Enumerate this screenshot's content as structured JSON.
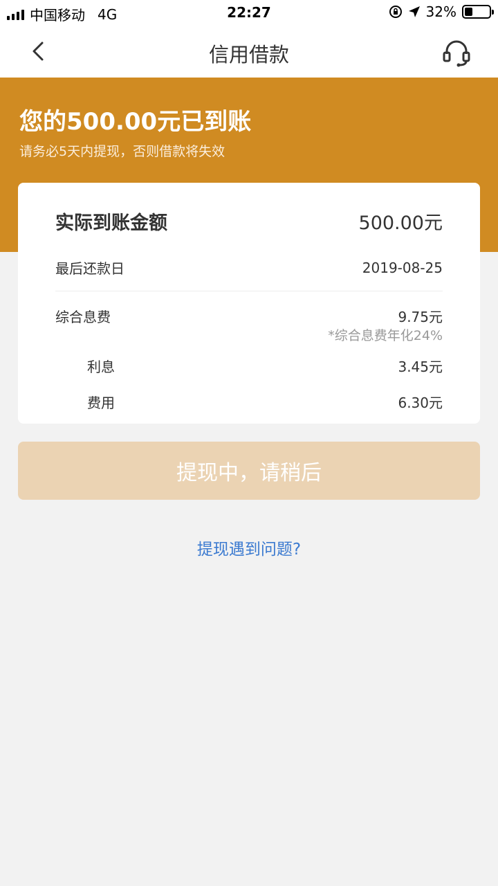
{
  "status_bar": {
    "carrier": "中国移动",
    "network": "4G",
    "time": "22:27",
    "battery_percent": "32%",
    "battery_level": 0.32
  },
  "nav": {
    "title": "信用借款"
  },
  "banner": {
    "title": "您的500.00元已到账",
    "subtitle": "请务必5天内提现，否则借款将失效"
  },
  "details": {
    "amount_label": "实际到账金额",
    "amount_value": "500.00元",
    "due_label": "最后还款日",
    "due_value": "2019-08-25",
    "fee_label": "综合息费",
    "fee_value": "9.75元",
    "fee_note": "*综合息费年化24%",
    "interest_label": "利息",
    "interest_value": "3.45元",
    "cost_label": "费用",
    "cost_value": "6.30元"
  },
  "actions": {
    "withdraw_label": "提现中，请稍后",
    "help_label": "提现遇到问题?"
  },
  "colors": {
    "brand": "#d08b22",
    "button_disabled": "#ebd3b3",
    "link": "#3b7ad0"
  }
}
